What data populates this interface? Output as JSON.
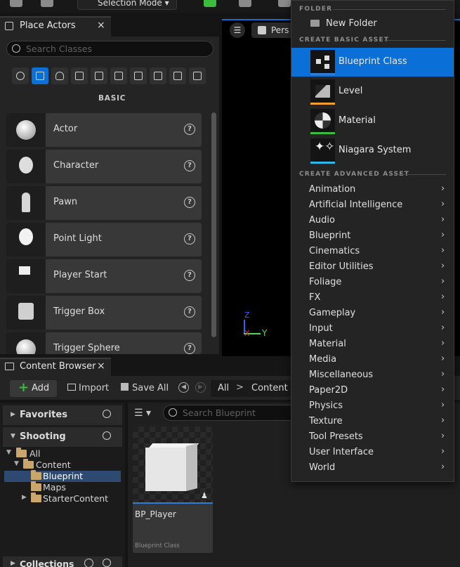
{
  "toolbar": {
    "mode_label": "Selection Mode"
  },
  "place_actors": {
    "tab_title": "Place Actors",
    "close": "×",
    "search_placeholder": "Search Classes",
    "section_label": "BASIC",
    "items": [
      {
        "label": "Actor",
        "icon": "sphere-icon"
      },
      {
        "label": "Character",
        "icon": "character-icon"
      },
      {
        "label": "Pawn",
        "icon": "pawn-icon"
      },
      {
        "label": "Point Light",
        "icon": "light-bulb-icon"
      },
      {
        "label": "Player Start",
        "icon": "flag-icon"
      },
      {
        "label": "Trigger Box",
        "icon": "box-icon"
      },
      {
        "label": "Trigger Sphere",
        "icon": "sphere-icon"
      }
    ],
    "help_glyph": "?"
  },
  "viewport": {
    "hamburger": "☰",
    "perspective_label": "Pers",
    "axis_z": "Z",
    "axis_y": "Y",
    "axis_x": "X"
  },
  "content_browser": {
    "tab_title": "Content Browser",
    "close": "×",
    "add_label": "Add",
    "import_label": "Import",
    "save_all_label": "Save All",
    "breadcrumb": [
      "All",
      "Content"
    ],
    "breadcrumb_sep": ">",
    "favorites_label": "Favorites",
    "shooting_label": "Shooting",
    "tree": [
      {
        "label": "All",
        "level": 0,
        "expanded": true,
        "selected": false
      },
      {
        "label": "Content",
        "level": 1,
        "expanded": true,
        "selected": false
      },
      {
        "label": "Blueprint",
        "level": 2,
        "expanded": false,
        "selected": true
      },
      {
        "label": "Maps",
        "level": 2,
        "expanded": false,
        "selected": false
      },
      {
        "label": "StarterContent",
        "level": 2,
        "expanded": false,
        "selected": false
      }
    ],
    "search_placeholder": "Search Blueprint",
    "asset": {
      "name": "BP_Player",
      "type": "Blueprint Class"
    },
    "collections_label": "Collections"
  },
  "add_menu": {
    "folder_header": "FOLDER",
    "new_folder_label": "New Folder",
    "basic_header": "CREATE BASIC ASSET",
    "basic_items": [
      {
        "label": "Blueprint Class",
        "icon": "blueprint-class-icon",
        "accent": "#2f7dd6",
        "selected": true
      },
      {
        "label": "Level",
        "icon": "level-icon",
        "accent": "#f0a030",
        "selected": false
      },
      {
        "label": "Material",
        "icon": "material-icon",
        "accent": "#3cbc3c",
        "selected": false
      },
      {
        "label": "Niagara System",
        "icon": "niagara-icon",
        "accent": "#2fb6e8",
        "selected": false
      }
    ],
    "advanced_header": "CREATE ADVANCED ASSET",
    "advanced_items": [
      "Animation",
      "Artificial Intelligence",
      "Audio",
      "Blueprint",
      "Cinematics",
      "Editor Utilities",
      "Foliage",
      "FX",
      "Gameplay",
      "Input",
      "Material",
      "Media",
      "Miscellaneous",
      "Paper2D",
      "Physics",
      "Texture",
      "Tool Presets",
      "User Interface",
      "World"
    ],
    "chevron": "›"
  },
  "colors": {
    "accent_blue": "#0a70d8",
    "add_green": "#3cbc3c",
    "panel_bg": "#242424"
  }
}
